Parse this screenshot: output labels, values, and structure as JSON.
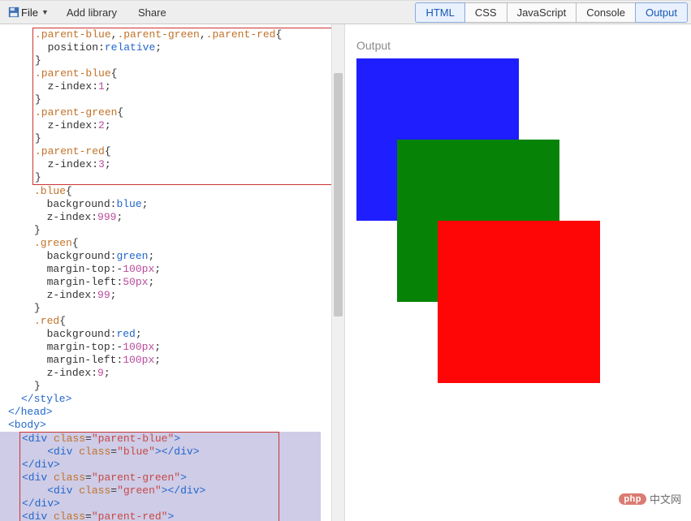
{
  "toolbar": {
    "file_label": "File",
    "add_library_label": "Add library",
    "share_label": "Share",
    "tabs": {
      "html": "HTML",
      "css": "CSS",
      "js": "JavaScript",
      "console": "Console",
      "output": "Output"
    }
  },
  "output": {
    "heading": "Output"
  },
  "code": {
    "css1_l1": ".parent-blue,.parent-green,.parent-red{",
    "css1_l2": "  position:relative;",
    "css1_l3": "}",
    "css1_l4": ".parent-blue{",
    "css1_l5": "  z-index:1;",
    "css1_l6": "}",
    "css1_l7": ".parent-green{",
    "css1_l8": "  z-index:2;",
    "css1_l9": "}",
    "css1_l10": ".parent-red{",
    "css1_l11": "  z-index:3;",
    "css1_l12": "}",
    "blue_l1": ".blue{",
    "blue_l2": "  background:blue;",
    "blue_l3": "  z-index:999;",
    "blue_l4": "}",
    "green_l1": ".green{",
    "green_l2": "  background:green;",
    "green_l3": "  margin-top:-100px;",
    "green_l4": "  margin-left:50px;",
    "green_l5": "  z-index:99;",
    "green_l6": "}",
    "red_l1": ".red{",
    "red_l2": "  background:red;",
    "red_l3": "  margin-top:-100px;",
    "red_l4": "  margin-left:100px;",
    "red_l5": "  z-index:9;",
    "red_l6": "}",
    "style_close": "</style>",
    "head_close": "</head>",
    "body_open": "<body>",
    "div_pb": "<div class=\"parent-blue\">",
    "div_blue": "    <div class=\"blue\"></div>",
    "div_close": "</div>",
    "div_pg": "<div class=\"parent-green\">",
    "div_green": "    <div class=\"green\"></div>",
    "div_pr": "<div class=\"parent-red\">"
  },
  "watermark": {
    "badge": "php",
    "text": "中文网"
  }
}
